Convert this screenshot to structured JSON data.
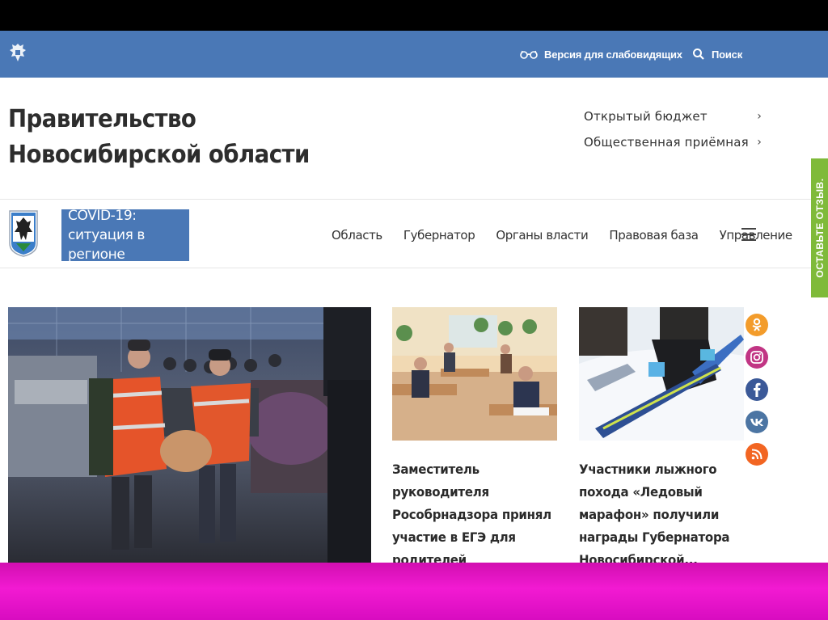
{
  "topbar": {
    "accessibility_label": "Версия для слабовидящих",
    "search_label": "Поиск"
  },
  "header": {
    "title_line1": "Правительство",
    "title_line2": "Новосибирской области",
    "links": [
      {
        "label": "Открытый бюджет",
        "chevron": "›"
      },
      {
        "label": "Общественная приёмная",
        "chevron": "›"
      }
    ]
  },
  "covid": {
    "line1": "COVID-19:",
    "line2": "ситуация в регионе"
  },
  "nav": [
    "Область",
    "Губернатор",
    "Органы власти",
    "Правовая база",
    "Управление"
  ],
  "news": [
    {
      "title": "Заместитель руководителя Рособрнадзора принял участие в ЕГЭ для родителей новосибирских..."
    },
    {
      "title": "Участники лыжного похода «Ледовый марафон» получили награды Губернатора Новосибирской..."
    }
  ],
  "social": [
    {
      "name": "odnoklassniki-icon",
      "glyph": "ok",
      "color": "#f39c2b"
    },
    {
      "name": "instagram-icon",
      "glyph": "◎",
      "color": "#c13584"
    },
    {
      "name": "facebook-icon",
      "glyph": "f",
      "color": "#3b5998"
    },
    {
      "name": "vk-icon",
      "glyph": "vk",
      "color": "#4c75a3"
    },
    {
      "name": "rss-icon",
      "glyph": "rss",
      "color": "#f26522"
    }
  ],
  "feedback_label": "ОСТАВЬТЕ ОТЗЫВ.",
  "colors": {
    "brand_blue": "#4a78b6",
    "feedback_green": "#7fba3a",
    "slide_band": "#e614c8"
  }
}
